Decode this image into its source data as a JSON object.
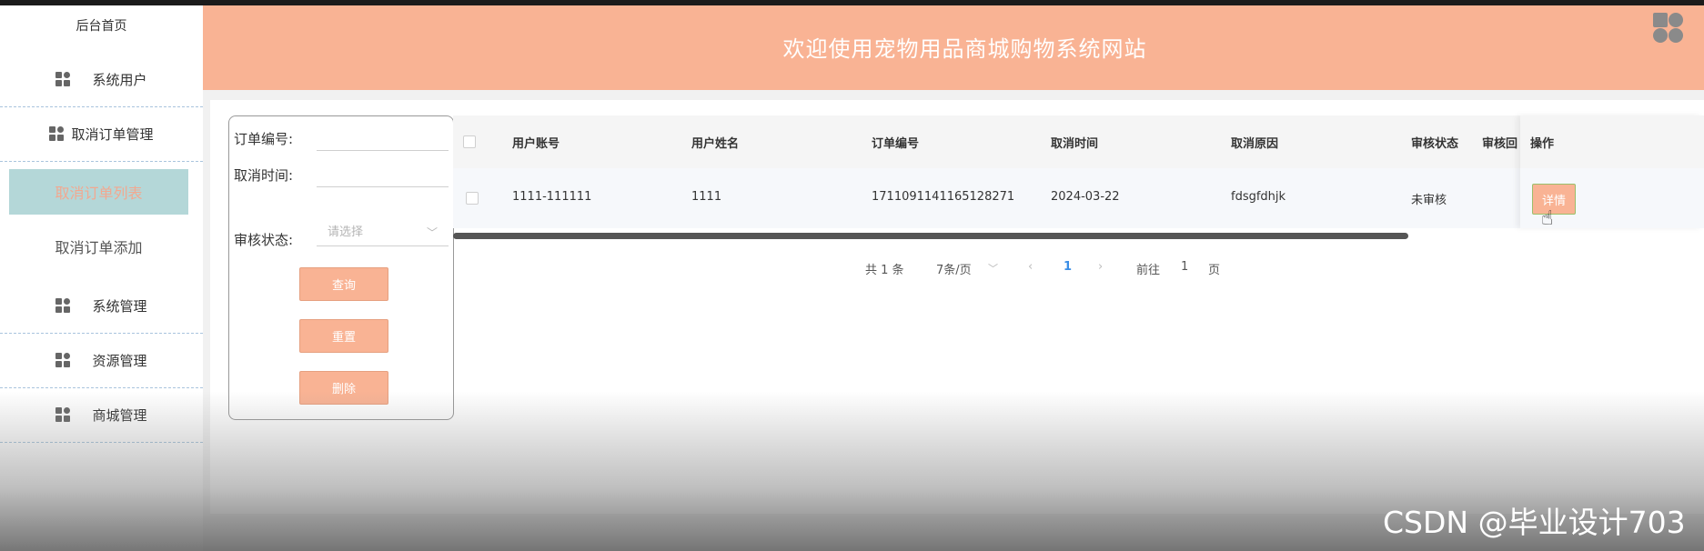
{
  "header": {
    "title": "欢迎使用宠物用品商城购物系统网站",
    "icon": "app-grid-icon"
  },
  "sidebar": {
    "home": "后台首页",
    "items": [
      {
        "label": "系统用户",
        "icon": "grid-icon"
      },
      {
        "label": "取消订单管理",
        "icon": "grid-icon"
      },
      {
        "label": "系统管理",
        "icon": "grid-icon"
      },
      {
        "label": "资源管理",
        "icon": "grid-icon"
      },
      {
        "label": "商城管理",
        "icon": "grid-icon"
      }
    ],
    "subitems": [
      {
        "label": "取消订单列表",
        "active": true
      },
      {
        "label": "取消订单添加",
        "active": false
      }
    ]
  },
  "search": {
    "order_no_label": "订单编号:",
    "order_no_value": "",
    "cancel_time_label": "取消时间:",
    "cancel_time_value": "",
    "audit_status_label": "审核状态:",
    "audit_status_placeholder": "请选择",
    "query_btn": "查询",
    "reset_btn": "重置",
    "delete_btn": "删除"
  },
  "table": {
    "columns": [
      "用户账号",
      "用户姓名",
      "订单编号",
      "取消时间",
      "取消原因",
      "审核状态",
      "审核回",
      "操作"
    ],
    "rows": [
      {
        "account": "1111-111111",
        "name": "1111",
        "order_no": "1711091141165128271",
        "cancel_time": "2024-03-22",
        "reason": "fdsgfdhjk",
        "status": "未审核",
        "action": "详情"
      }
    ]
  },
  "pagination": {
    "total": "共 1 条",
    "page_size": "7条/页",
    "prev": "‹",
    "current": "1",
    "next": "›",
    "goto_label": "前往",
    "goto_value": "1",
    "page_unit": "页"
  },
  "watermark": "CSDN @毕业设计703",
  "colors": {
    "accent": "#f9b394",
    "active_bg": "#b4d7d8",
    "active_text": "#f2a890",
    "link": "#3a8ee6"
  }
}
